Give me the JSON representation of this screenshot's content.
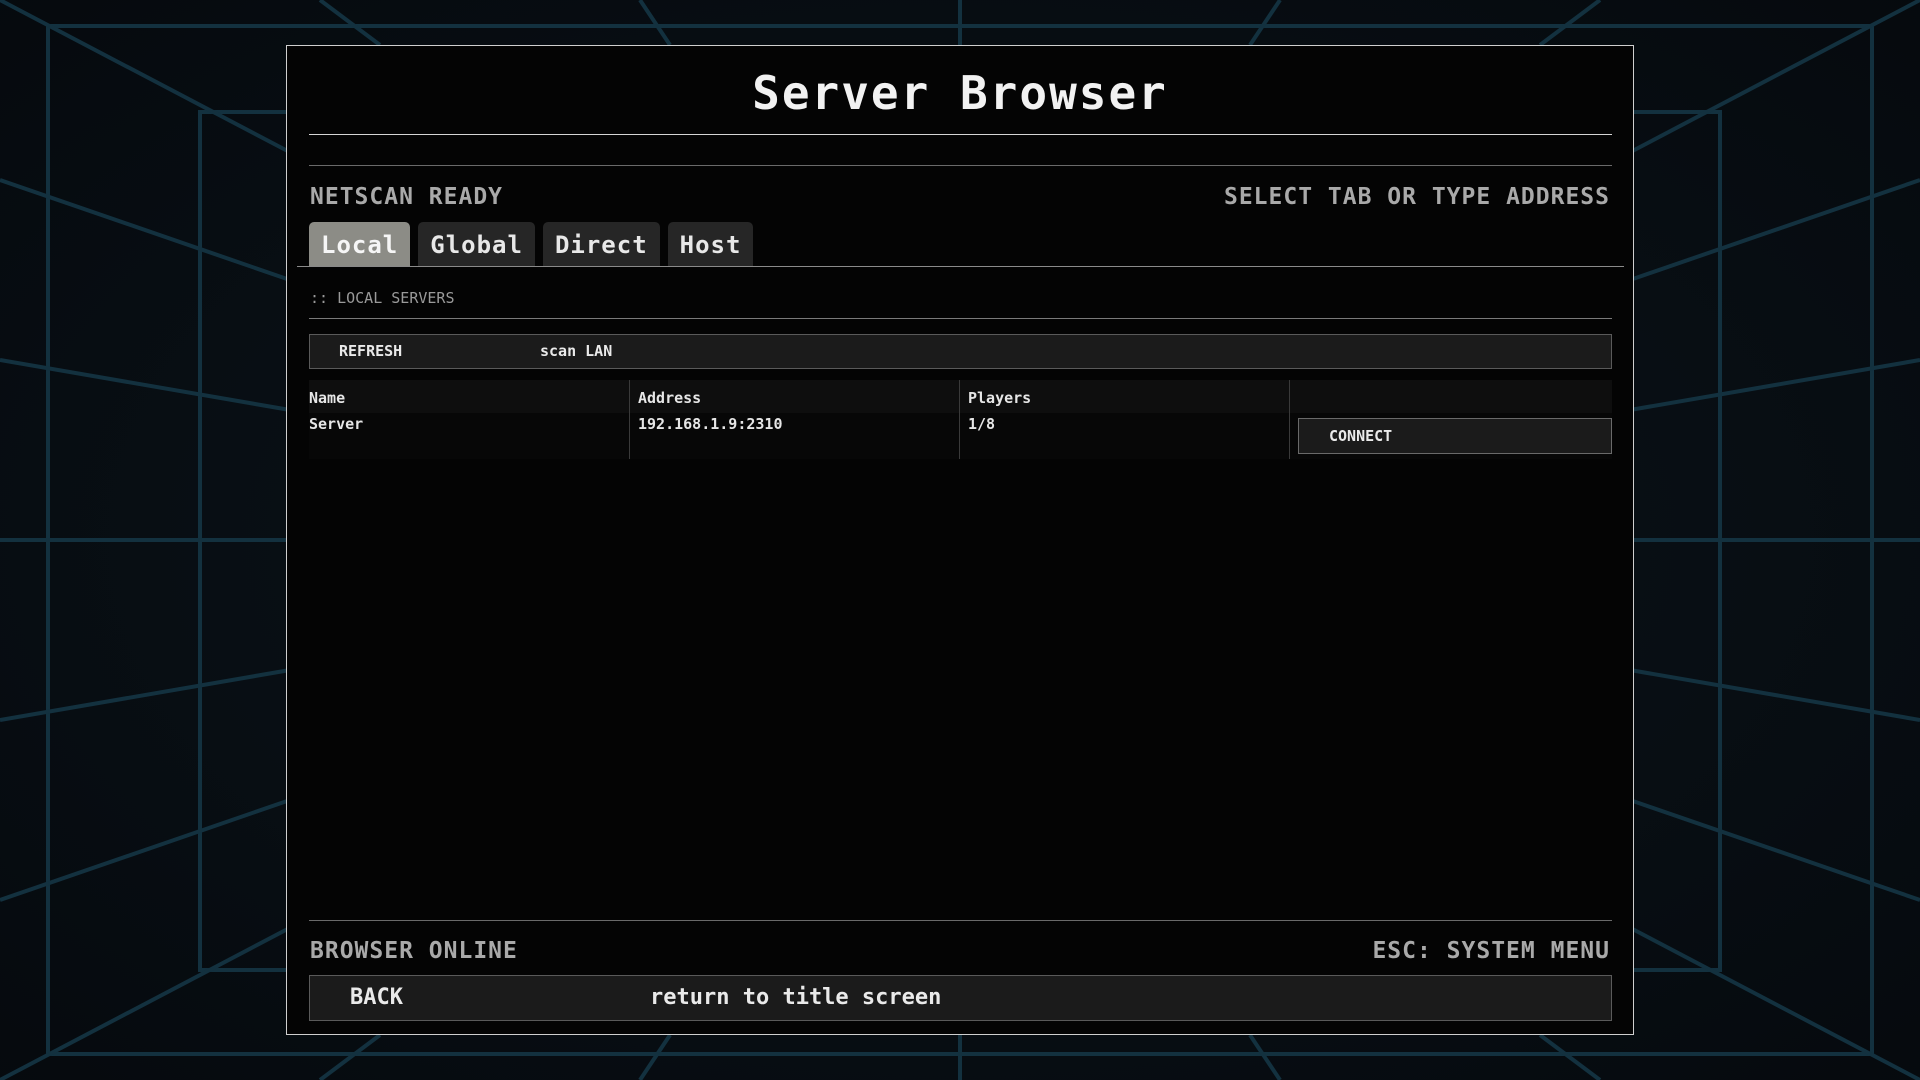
{
  "title": "Server Browser",
  "status": {
    "left": "NETSCAN READY",
    "right": "SELECT TAB OR TYPE ADDRESS"
  },
  "tabs": [
    {
      "label": "Local",
      "active": true
    },
    {
      "label": "Global",
      "active": false
    },
    {
      "label": "Direct",
      "active": false
    },
    {
      "label": "Host",
      "active": false
    }
  ],
  "section": {
    "label": ":: LOCAL SERVERS"
  },
  "refresh": {
    "label": "REFRESH",
    "description": "scan LAN"
  },
  "table": {
    "headers": [
      "Name",
      "Address",
      "Players",
      ""
    ],
    "rows": [
      {
        "name": "Server",
        "address": "192.168.1.9:2310",
        "players": "1/8",
        "action": "CONNECT"
      }
    ]
  },
  "footer": {
    "left": "BROWSER ONLINE",
    "right": "ESC: SYSTEM MENU",
    "back_label": "BACK",
    "back_description": "return to title screen"
  },
  "colors": {
    "background": "#060b10",
    "grid_line": "#12303f",
    "panel": "#040404",
    "tab_active": "#8c8c86",
    "tab_inactive": "#262626"
  }
}
